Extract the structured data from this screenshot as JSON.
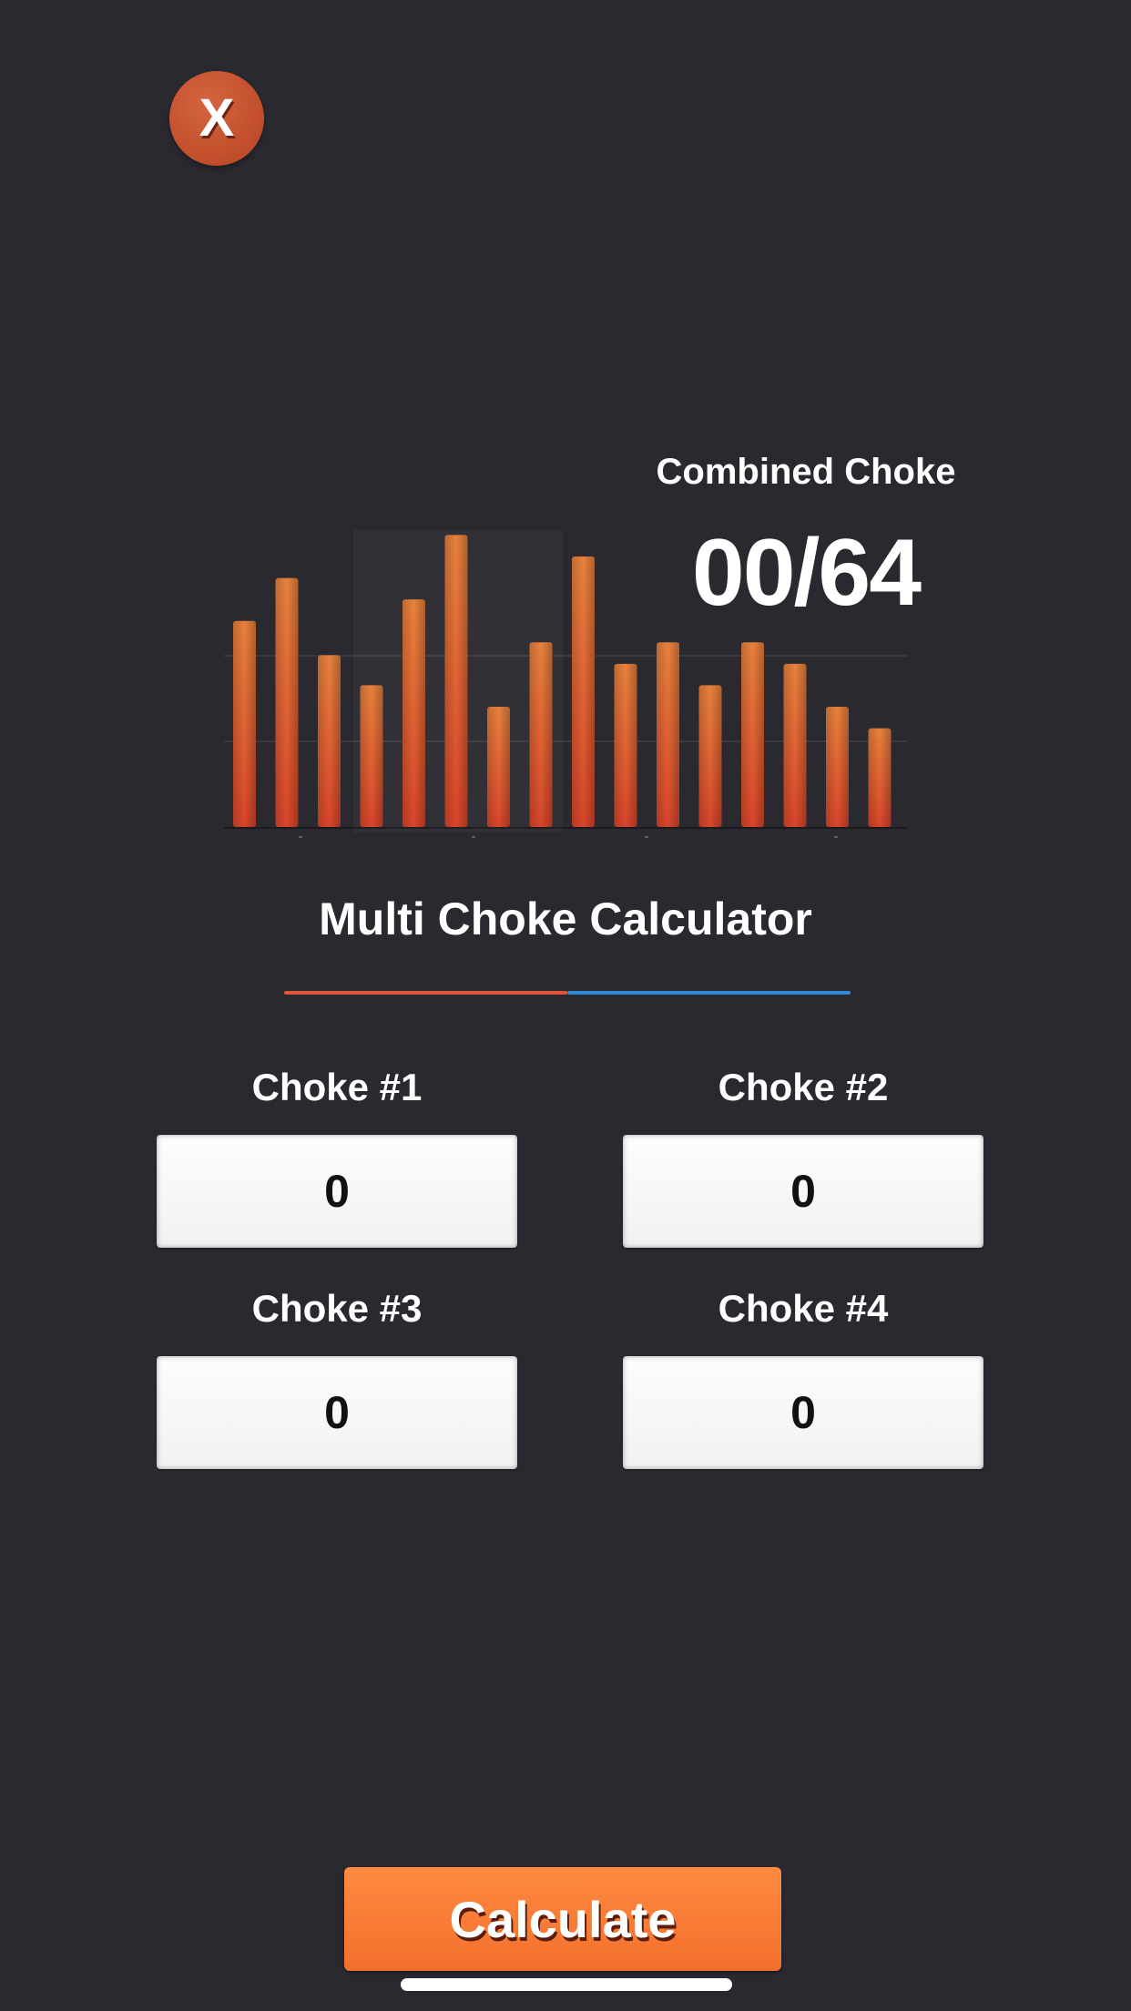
{
  "close_button": {
    "label": "X"
  },
  "combined": {
    "label": "Combined Choke",
    "value": "00/64"
  },
  "title": "Multi Choke Calculator",
  "fields": [
    {
      "label": "Choke #1",
      "value": "0"
    },
    {
      "label": "Choke #2",
      "value": "0"
    },
    {
      "label": "Choke #3",
      "value": "0"
    },
    {
      "label": "Choke #4",
      "value": "0"
    }
  ],
  "calculate_button": {
    "label": "Calculate"
  },
  "colors": {
    "background": "#2a2930",
    "accent_orange": "#f26f2c",
    "divider_red": "#e0553a",
    "divider_blue": "#2e88d8"
  },
  "decor_chart": {
    "type": "bar",
    "values": [
      48,
      58,
      40,
      33,
      53,
      68,
      28,
      43,
      63,
      38,
      43,
      33,
      43,
      38,
      28,
      23
    ],
    "ylim": [
      0,
      70
    ]
  }
}
